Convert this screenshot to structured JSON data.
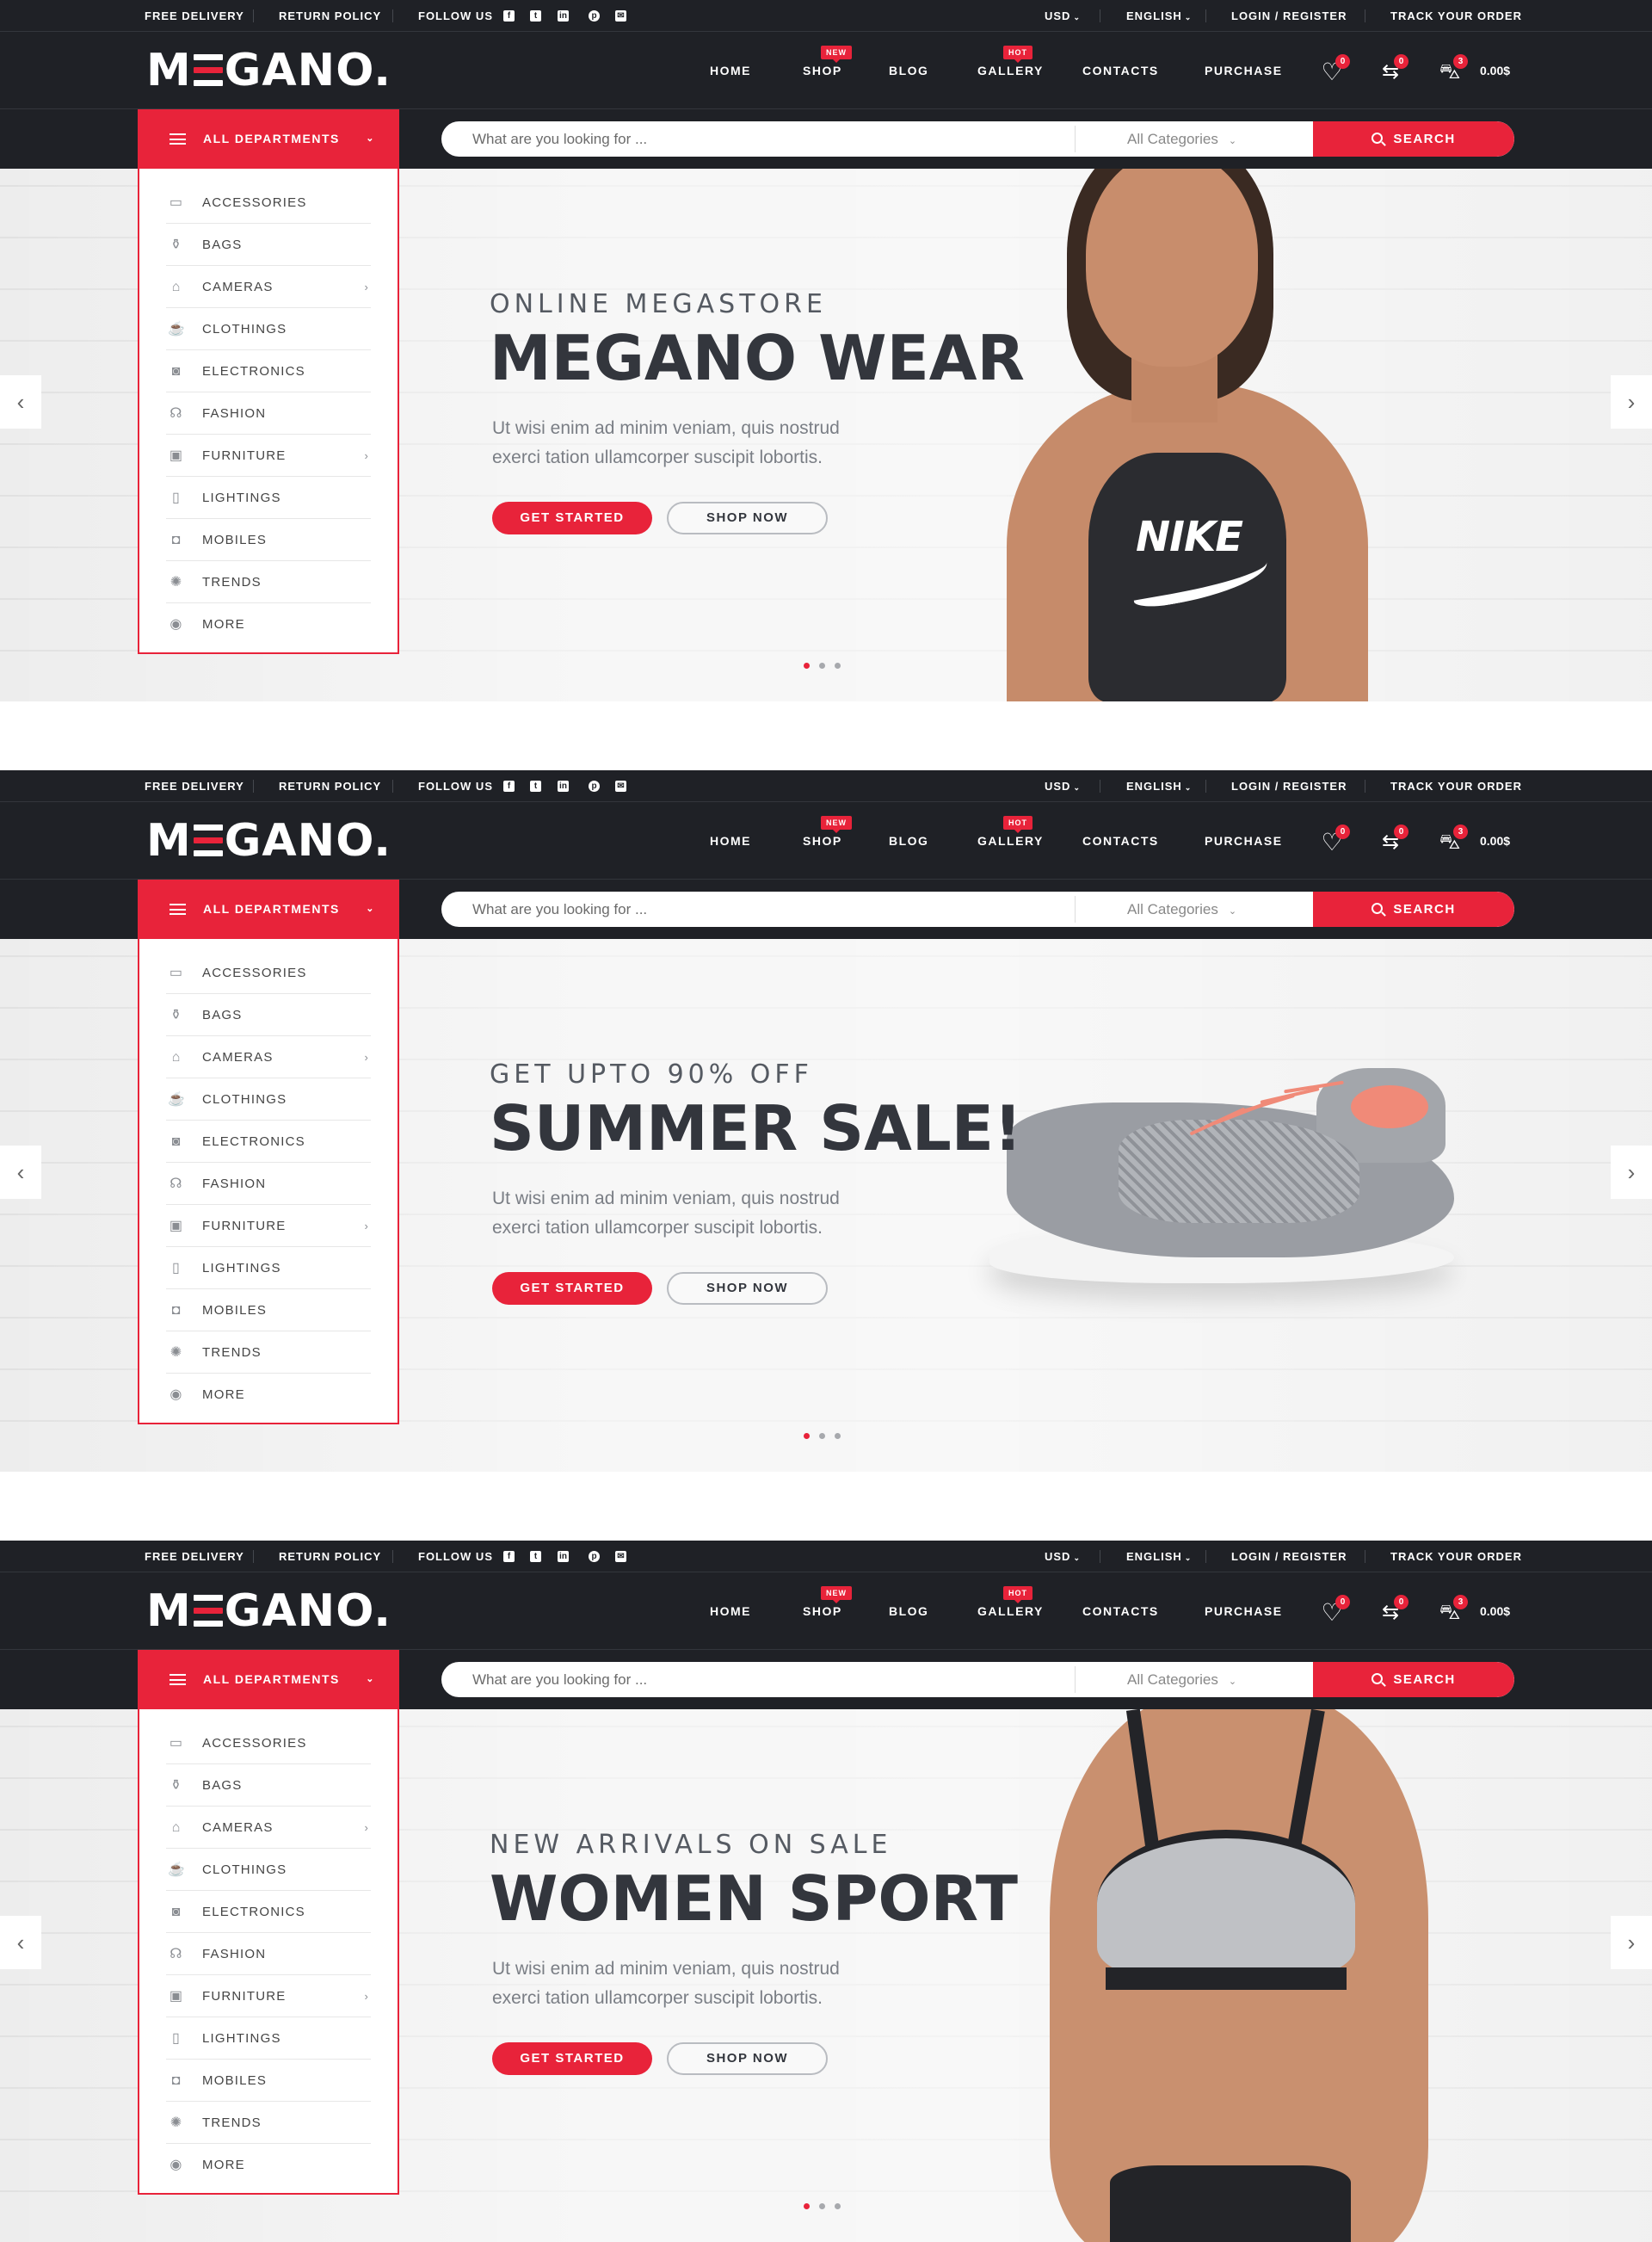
{
  "topbar": {
    "free_delivery": "FREE DELIVERY",
    "return_policy": "RETURN POLICY",
    "follow_us": "FOLLOW US",
    "social": [
      "facebook-icon",
      "twitter-icon",
      "linkedin-icon",
      "pinterest-icon",
      "mail-icon"
    ],
    "currency": "USD",
    "language": "ENGLISH",
    "login": "LOGIN / REGISTER",
    "track": "TRACK YOUR ORDER"
  },
  "header": {
    "logo_left": "M",
    "logo_right": "GANO.",
    "nav": [
      {
        "label": "HOME",
        "badge": ""
      },
      {
        "label": "SHOP",
        "badge": "NEW"
      },
      {
        "label": "BLOG",
        "badge": ""
      },
      {
        "label": "GALLERY",
        "badge": "HOT"
      },
      {
        "label": "CONTACTS",
        "badge": ""
      },
      {
        "label": "PURCHASE",
        "badge": ""
      }
    ],
    "wishlist_count": "0",
    "compare_count": "0",
    "cart_count": "3",
    "cart_total": "0.00$"
  },
  "search": {
    "departments_label": "ALL DEPARTMENTS",
    "placeholder": "What are you looking for ...",
    "category": "All Categories",
    "button": "SEARCH"
  },
  "departments": [
    {
      "label": "ACCESSORIES",
      "icon": "monitor-icon",
      "has_sub": false
    },
    {
      "label": "BAGS",
      "icon": "blender-icon",
      "has_sub": false
    },
    {
      "label": "CAMERAS",
      "icon": "lamp-icon",
      "has_sub": true
    },
    {
      "label": "CLOTHINGS",
      "icon": "coffee-machine-icon",
      "has_sub": false
    },
    {
      "label": "ELECTRONICS",
      "icon": "washing-machine-icon",
      "has_sub": false
    },
    {
      "label": "FASHION",
      "icon": "headphones-icon",
      "has_sub": false
    },
    {
      "label": "FURNITURE",
      "icon": "desktop-icon",
      "has_sub": true
    },
    {
      "label": "LIGHTINGS",
      "icon": "phone-icon",
      "has_sub": false
    },
    {
      "label": "MOBILES",
      "icon": "speaker-icon",
      "has_sub": false
    },
    {
      "label": "TRENDS",
      "icon": "settings-icon",
      "has_sub": false
    },
    {
      "label": "MORE",
      "icon": "camera-icon",
      "has_sub": false
    }
  ],
  "hero_buttons": {
    "start": "GET STARTED",
    "shop": "SHOP NOW"
  },
  "slides": [
    {
      "eyebrow": "ONLINE MEGASTORE",
      "headline": "MEGANO WEAR",
      "copy_line1": "Ut wisi enim ad minim veniam, quis nostrud",
      "copy_line2": "exerci tation ullamcorper suscipit lobortis.",
      "brand": "NIKE",
      "active_dot": 1
    },
    {
      "eyebrow": "GET UPTO 90% OFF",
      "headline": "SUMMER SALE!",
      "copy_line1": "Ut wisi enim ad minim veniam, quis nostrud",
      "copy_line2": "exerci tation ullamcorper suscipit lobortis.",
      "brand": "",
      "active_dot": 1
    },
    {
      "eyebrow": "NEW ARRIVALS ON SALE",
      "headline": "WOMEN SPORT",
      "copy_line1": "Ut wisi enim ad minim veniam, quis nostrud",
      "copy_line2": "exerci tation ullamcorper suscipit lobortis.",
      "brand": "",
      "active_dot": 1
    }
  ],
  "colors": {
    "accent": "#e8233a",
    "dark": "#1f2126",
    "heading": "#33363d"
  }
}
